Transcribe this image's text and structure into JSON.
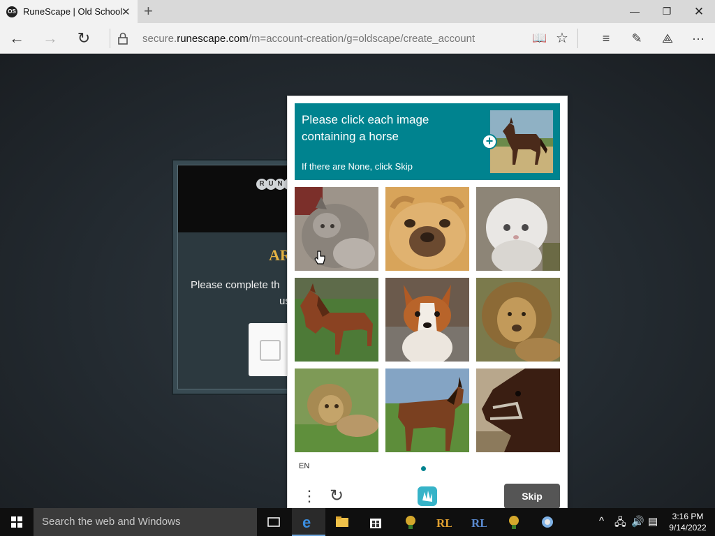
{
  "browser": {
    "tab_title": "RuneScape | Old School",
    "tab_favicon_text": "OS",
    "new_tab_icon": "plus-icon",
    "url_prefix": "secure.",
    "url_host": "runescape.com",
    "url_path": "/m=account-creation/g=oldscape/create_account"
  },
  "page": {
    "logo_letters": [
      "R",
      "U",
      "N",
      "E"
    ],
    "heading_fragment": "AR",
    "text_fragment": "Please complete th",
    "text_fragment_2": "us"
  },
  "captcha": {
    "prompt_title": "Please click each image containing a horse",
    "prompt_sub": "If there are None, click Skip",
    "target": "horse",
    "tiles": [
      {
        "content": "cat"
      },
      {
        "content": "pug dog"
      },
      {
        "content": "white kitten"
      },
      {
        "content": "horse"
      },
      {
        "content": "corgi"
      },
      {
        "content": "lion"
      },
      {
        "content": "lion lying"
      },
      {
        "content": "horse"
      },
      {
        "content": "horse with halter"
      }
    ],
    "language": "EN",
    "skip_label": "Skip",
    "accent_color": "#00838f"
  },
  "taskbar": {
    "search_placeholder": "Search the web and Windows",
    "time": "3:16 PM",
    "date": "9/14/2022"
  }
}
